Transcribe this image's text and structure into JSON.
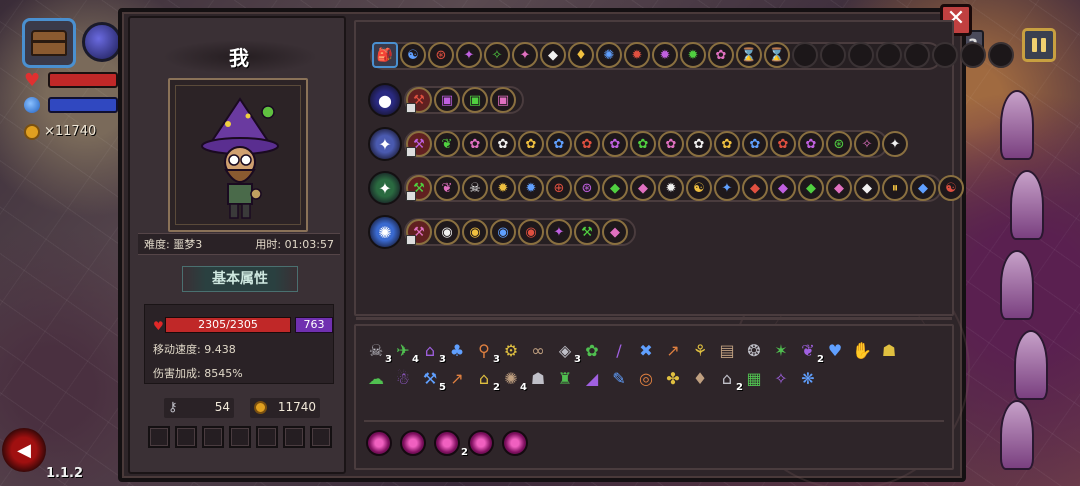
{
  "hud": {
    "gold_text": "×11740",
    "version": "1.1.2"
  },
  "panel": {
    "close_label": "✕"
  },
  "player": {
    "name": "我",
    "difficulty": "难度: 噩梦3",
    "time": "用时: 01:03:57",
    "section_title": "基本属性",
    "hp": "2305/2305",
    "mp": "763",
    "move_speed": "移动速度: 9.438",
    "damage_bonus": "伤害加成: 8545%",
    "keys": "54",
    "gold": "11740"
  },
  "weapon_rows": [
    {
      "icons": [
        "🎒",
        "☯",
        "⊛",
        "✦",
        "✧",
        "✦",
        "◆",
        "♦",
        "✺",
        "✹",
        "✹",
        "✹",
        "✿",
        "⌛",
        "⌛",
        "",
        "",
        "",
        "",
        "",
        "",
        "",
        ""
      ]
    },
    {
      "icons": [
        "●",
        "⚒",
        "▣",
        "▣",
        "▣"
      ]
    },
    {
      "icons": [
        "✦",
        "⚒",
        "❦",
        "✿",
        "✿",
        "✿",
        "✿",
        "✿",
        "✿",
        "✿",
        "✿",
        "✿",
        "✿",
        "✿",
        "✿",
        "✿",
        "⊛",
        "✧",
        "✦"
      ]
    },
    {
      "icons": [
        "✦",
        "⚒",
        "❦",
        "☠",
        "✹",
        "✹",
        "⊕",
        "⊛",
        "◆",
        "◆",
        "✹",
        "☯",
        "✦",
        "◆",
        "◆",
        "◆",
        "◆",
        "◆",
        "⏸",
        "◆",
        "☯"
      ]
    },
    {
      "icons": [
        "✺",
        "⚒",
        "◉",
        "◉",
        "◉",
        "◉",
        "✦",
        "⚒",
        "◆"
      ]
    }
  ],
  "items_row1": [
    {
      "g": "☠",
      "c": "3"
    },
    {
      "g": "✈",
      "c": "4"
    },
    {
      "g": "⌂",
      "c": "3"
    },
    {
      "g": "♣",
      "c": ""
    },
    {
      "g": "⚲",
      "c": "3"
    },
    {
      "g": "⚙",
      "c": ""
    },
    {
      "g": "∞",
      "c": ""
    },
    {
      "g": "◈",
      "c": "3"
    },
    {
      "g": "✿",
      "c": ""
    },
    {
      "g": "/",
      "c": ""
    },
    {
      "g": "✖",
      "c": ""
    },
    {
      "g": "↗",
      "c": ""
    },
    {
      "g": "⚘",
      "c": ""
    },
    {
      "g": "▤",
      "c": ""
    },
    {
      "g": "❂",
      "c": ""
    },
    {
      "g": "✶",
      "c": ""
    },
    {
      "g": "❦",
      "c": "2"
    },
    {
      "g": "♥",
      "c": ""
    },
    {
      "g": "✋",
      "c": ""
    },
    {
      "g": "☗",
      "c": ""
    }
  ],
  "items_row2": [
    {
      "g": "☁",
      "c": ""
    },
    {
      "g": "☃",
      "c": ""
    },
    {
      "g": "⚒",
      "c": "5"
    },
    {
      "g": "↗",
      "c": ""
    },
    {
      "g": "⌂",
      "c": "2"
    },
    {
      "g": "✺",
      "c": "4"
    },
    {
      "g": "☗",
      "c": ""
    },
    {
      "g": "♜",
      "c": ""
    },
    {
      "g": "◢",
      "c": ""
    },
    {
      "g": "✎",
      "c": ""
    },
    {
      "g": "◎",
      "c": ""
    },
    {
      "g": "✤",
      "c": ""
    },
    {
      "g": "♦",
      "c": ""
    },
    {
      "g": "⌂",
      "c": "2"
    },
    {
      "g": "▦",
      "c": ""
    },
    {
      "g": "✧",
      "c": ""
    },
    {
      "g": "❋",
      "c": ""
    }
  ],
  "orbs": [
    {
      "c": ""
    },
    {
      "c": ""
    },
    {
      "c": "2"
    },
    {
      "c": ""
    },
    {
      "c": ""
    }
  ]
}
